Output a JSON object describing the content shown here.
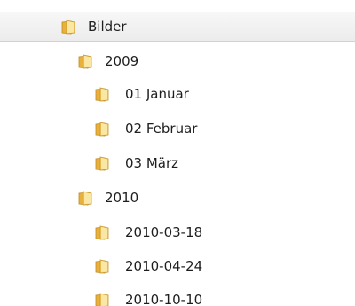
{
  "tree": {
    "root": {
      "label": "Bilder",
      "selected": true,
      "icon": "folder-icon"
    },
    "y2009": {
      "label": "2009",
      "icon": "folder-icon",
      "children": [
        {
          "label": "01 Januar",
          "icon": "folder-icon"
        },
        {
          "label": "02 Februar",
          "icon": "folder-icon"
        },
        {
          "label": "03 März",
          "icon": "folder-icon"
        }
      ]
    },
    "y2010": {
      "label": "2010",
      "icon": "folder-icon",
      "children": [
        {
          "label": "2010-03-18",
          "icon": "folder-icon"
        },
        {
          "label": "2010-04-24",
          "icon": "folder-icon"
        },
        {
          "label": "2010-10-10",
          "icon": "folder-icon"
        }
      ]
    }
  },
  "colors": {
    "selection_background": "#eeeeee",
    "folder_yellow": "#f2c14e",
    "text": "#1e1e1e"
  }
}
